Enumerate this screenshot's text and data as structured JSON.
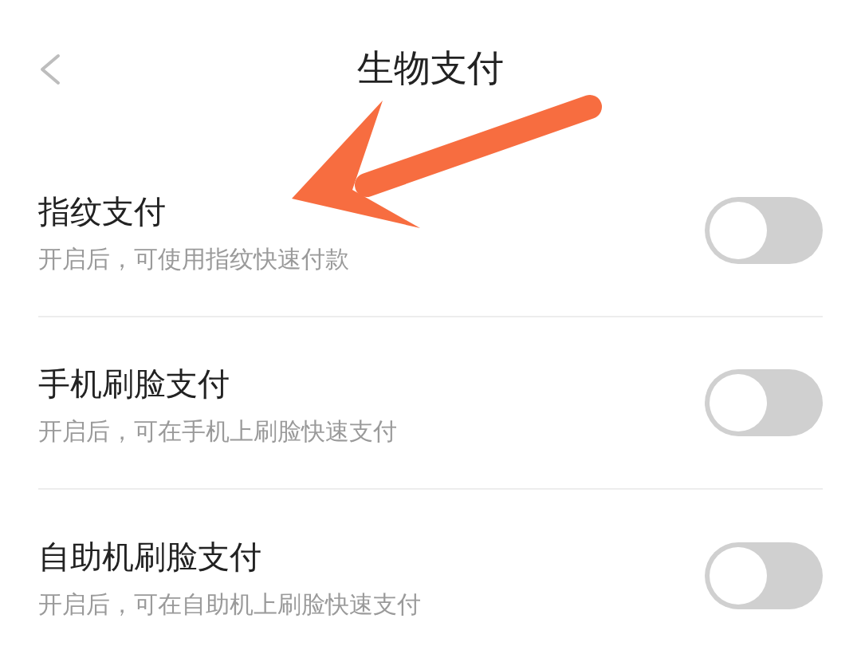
{
  "header": {
    "title": "生物支付"
  },
  "settings": [
    {
      "label": "指纹支付",
      "description": "开启后，可使用指纹快速付款",
      "on": false
    },
    {
      "label": "手机刷脸支付",
      "description": "开启后，可在手机上刷脸快速支付",
      "on": false
    },
    {
      "label": "自助机刷脸支付",
      "description": "开启后，可在自助机上刷脸快速支付",
      "on": false
    }
  ]
}
